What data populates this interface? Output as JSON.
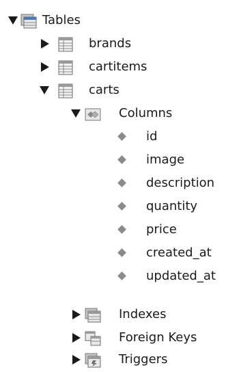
{
  "tree": {
    "tables_label": "Tables",
    "tables": [
      {
        "label": "brands"
      },
      {
        "label": "cartitems"
      },
      {
        "label": "carts"
      }
    ],
    "carts": {
      "columns_label": "Columns",
      "columns": [
        "id",
        "image",
        "description",
        "quantity",
        "price",
        "created_at",
        "updated_at"
      ],
      "indexes_label": "Indexes",
      "foreign_keys_label": "Foreign Keys",
      "triggers_label": "Triggers"
    }
  },
  "colors": {
    "text": "#1a1a1a",
    "icon_gray": "#8a8a8a",
    "folder_blue": "#4d79b5"
  },
  "icons": {
    "tables_folder": "folder-table-icon",
    "table": "table-icon",
    "columns_folder": "folder-columns-icon",
    "column": "column-diamond-icon",
    "indexes": "indexes-icon",
    "foreign_keys": "foreign-keys-icon",
    "triggers": "triggers-icon"
  }
}
